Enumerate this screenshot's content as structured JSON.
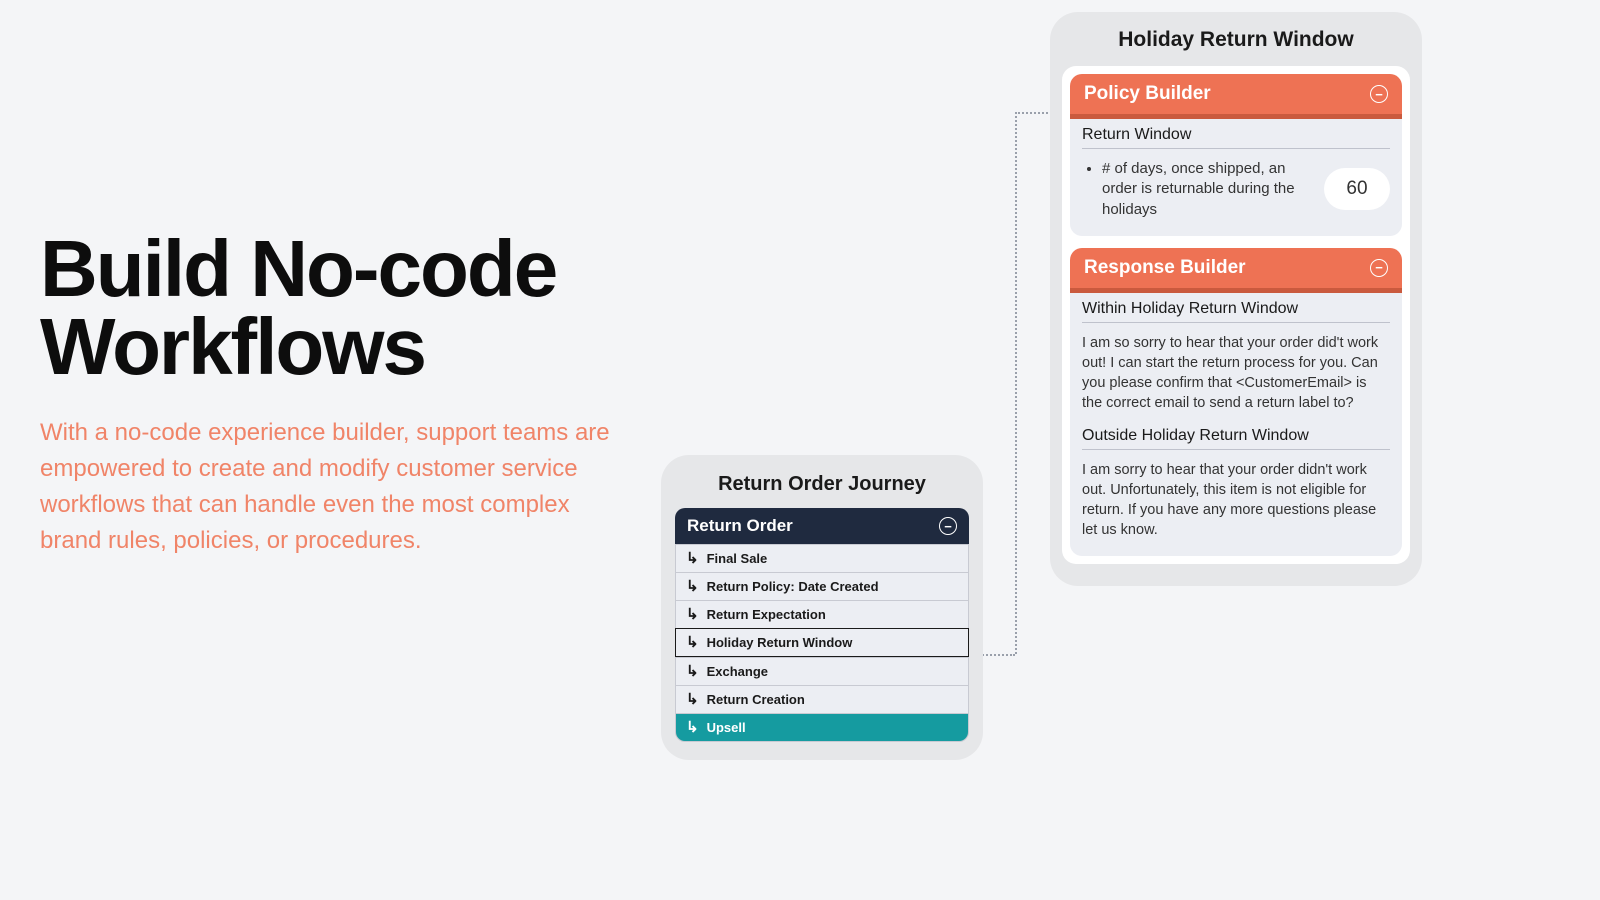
{
  "hero": {
    "title": "Build No-code Workflows",
    "subtitle": "With a no-code experience builder, support teams are empowered to create and modify customer service workflows that can handle even the most complex brand rules, policies, or procedures."
  },
  "journey": {
    "title": "Return Order Journey",
    "header": "Return Order",
    "steps": [
      {
        "label": "Final Sale",
        "state": "normal"
      },
      {
        "label": "Return Policy: Date Created",
        "state": "normal"
      },
      {
        "label": "Return Expectation",
        "state": "normal"
      },
      {
        "label": "Holiday Return Window",
        "state": "selected"
      },
      {
        "label": "Exchange",
        "state": "normal"
      },
      {
        "label": "Return Creation",
        "state": "normal"
      },
      {
        "label": "Upsell",
        "state": "highlight"
      }
    ]
  },
  "detail": {
    "title": "Holiday Return Window",
    "policy": {
      "header": "Policy Builder",
      "section_label": "Return Window",
      "bullet": "# of days, once shipped, an order is returnable during the holidays",
      "value": "60"
    },
    "response": {
      "header": "Response Builder",
      "within_label": "Within Holiday Return Window",
      "within_text": "I am so sorry to hear that your order did't work out! I can start the return process for you. Can you please confirm that <CustomerEmail> is the correct email to send a return label to?",
      "outside_label": "Outside Holiday Return Window",
      "outside_text": "I am sorry to hear that your order didn't work out.  Unfortunately, this item is not eligible for return. If you have any more questions please let us know."
    }
  }
}
